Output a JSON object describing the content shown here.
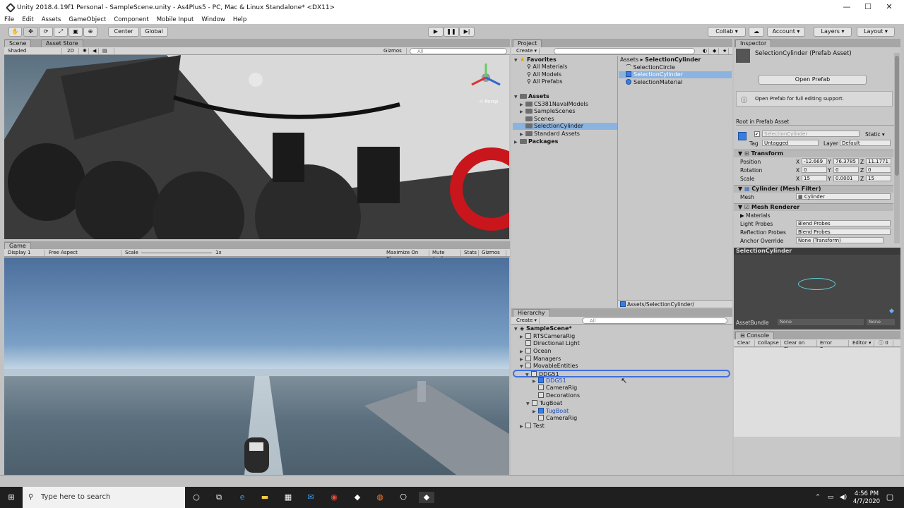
{
  "window": {
    "title": "Unity 2018.4.19f1 Personal - SampleScene.unity - As4Plus5 - PC, Mac & Linux Standalone* <DX11>",
    "minimize": "—",
    "maximize": "☐",
    "close": "✕"
  },
  "menu": [
    "File",
    "Edit",
    "Assets",
    "GameObject",
    "Component",
    "Mobile Input",
    "Window",
    "Help"
  ],
  "toolbar": {
    "center": "Center",
    "global": "Global",
    "collab": "Collab ▾",
    "cloud": "☁",
    "account": "Account ▾",
    "layers": "Layers ▾",
    "layout": "Layout ▾",
    "play": "▶",
    "pause": "❚❚",
    "step": "▶|"
  },
  "scene": {
    "tab_scene": "Scene",
    "tab_store": "Asset Store",
    "shaded": "Shaded",
    "mode2d": "2D",
    "gizmos": "Gizmos ▾",
    "search": "All",
    "persp": "< Persp"
  },
  "game": {
    "tab": "Game",
    "display": "Display 1",
    "aspect": "Free Aspect",
    "scale": "Scale",
    "scale_val": "1x",
    "maximize": "Maximize On Play",
    "mute": "Mute Audio",
    "stats": "Stats",
    "gizmos": "Gizmos ▾"
  },
  "project": {
    "tab": "Project",
    "create": "Create ▾",
    "favorites": "Favorites",
    "fav_items": [
      "All Materials",
      "All Models",
      "All Prefabs"
    ],
    "assets": "Assets",
    "asset_items": [
      "CS381NavalModels",
      "SampleScenes",
      "Scenes",
      "SelectionCylinder",
      "Standard Assets"
    ],
    "packages": "Packages",
    "breadcrumb_root": "Assets",
    "breadcrumb_leaf": "SelectionCylinder",
    "files": [
      "SelectionCircle",
      "SelectionCylinder",
      "SelectionMaterial"
    ],
    "path": "Assets/SelectionCylinder/"
  },
  "hierarchy": {
    "tab": "Hierarchy",
    "create": "Create ▾",
    "search": "All",
    "scene": "SampleScene*",
    "items": [
      "RTSCameraRig",
      "Directional Light",
      "Ocean",
      "Managers",
      "MovableEntities",
      "DDG51",
      "DDG51",
      "CameraRig",
      "Decorations",
      "TugBoat",
      "TugBoat",
      "CameraRig",
      "Test"
    ]
  },
  "inspector": {
    "tab": "Inspector",
    "title": "SelectionCylinder (Prefab Asset)",
    "open_prefab": "Open Prefab",
    "info": "Open Prefab for full editing support.",
    "root": "Root in Prefab Asset",
    "name": "SelectionCylinder",
    "static": "Static ▾",
    "tag_label": "Tag",
    "tag": "Untagged",
    "layer_label": "Layer",
    "layer": "Default",
    "transform": "Transform",
    "position": "Position",
    "rotation": "Rotation",
    "scale": "Scale",
    "pos": [
      "-12.669",
      "76.3785",
      "11.1771"
    ],
    "rot": [
      "0",
      "0",
      "0"
    ],
    "scl": [
      "15",
      "0.0001",
      "15"
    ],
    "meshfilter": "Cylinder (Mesh Filter)",
    "mesh_label": "Mesh",
    "mesh": "Cylinder",
    "meshrenderer": "Mesh Renderer",
    "materials": "Materials",
    "light_probes": "Light Probes",
    "light_probes_val": "Blend Probes",
    "refl_probes": "Reflection Probes",
    "refl_probes_val": "Blend Probes",
    "anchor": "Anchor Override",
    "anchor_val": "None (Transform)",
    "preview_title": "SelectionCylinder",
    "assetbundle": "AssetBundle",
    "ab_none": "None",
    "ab_none2": "None"
  },
  "console": {
    "tab": "Console",
    "clear": "Clear",
    "collapse": "Collapse",
    "clear_on_play": "Clear on Play",
    "error_pause": "Error Pause",
    "editor": "Editor ▾",
    "count": "0"
  },
  "taskbar": {
    "search": "Type here to search",
    "time": "4:56 PM",
    "date": "4/7/2020"
  }
}
